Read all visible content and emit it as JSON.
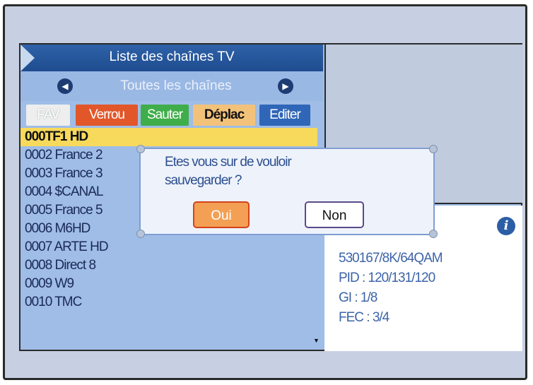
{
  "title": "Liste des chaînes TV",
  "filter": "Toutes les chaînes",
  "buttons": {
    "fav": "FAV",
    "verrou": "Verrou",
    "sauter": "Sauter",
    "deplac": "Déplac",
    "editer": "Editer"
  },
  "channels": [
    "000TF1 HD",
    "0002 France 2",
    "0003 France 3",
    "0004 $CANAL",
    "0005 France 5",
    "0006 M6HD",
    "0007 ARTE HD",
    "0008 Direct 8",
    "0009 W9",
    "0010 TMC"
  ],
  "info": {
    "freq": "530167/8K/64QAM",
    "pid": "PID : 120/131/120",
    "gi": "GI : 1/8",
    "fec": "FEC : 3/4"
  },
  "dialog": {
    "message_line1": "Etes vous sur de vouloir",
    "message_line2": "sauvegarder ?",
    "yes": "Oui",
    "no": "Non"
  },
  "icons": {
    "arrow_left": "arrow-left-icon",
    "arrow_right": "arrow-right-icon",
    "info": "info-icon"
  },
  "colors": {
    "verrou": "#e2572a",
    "sauter": "#3fae4a",
    "deplac": "#f2c27a",
    "editer": "#2f66b8",
    "selected_row": "#f7d95c"
  }
}
